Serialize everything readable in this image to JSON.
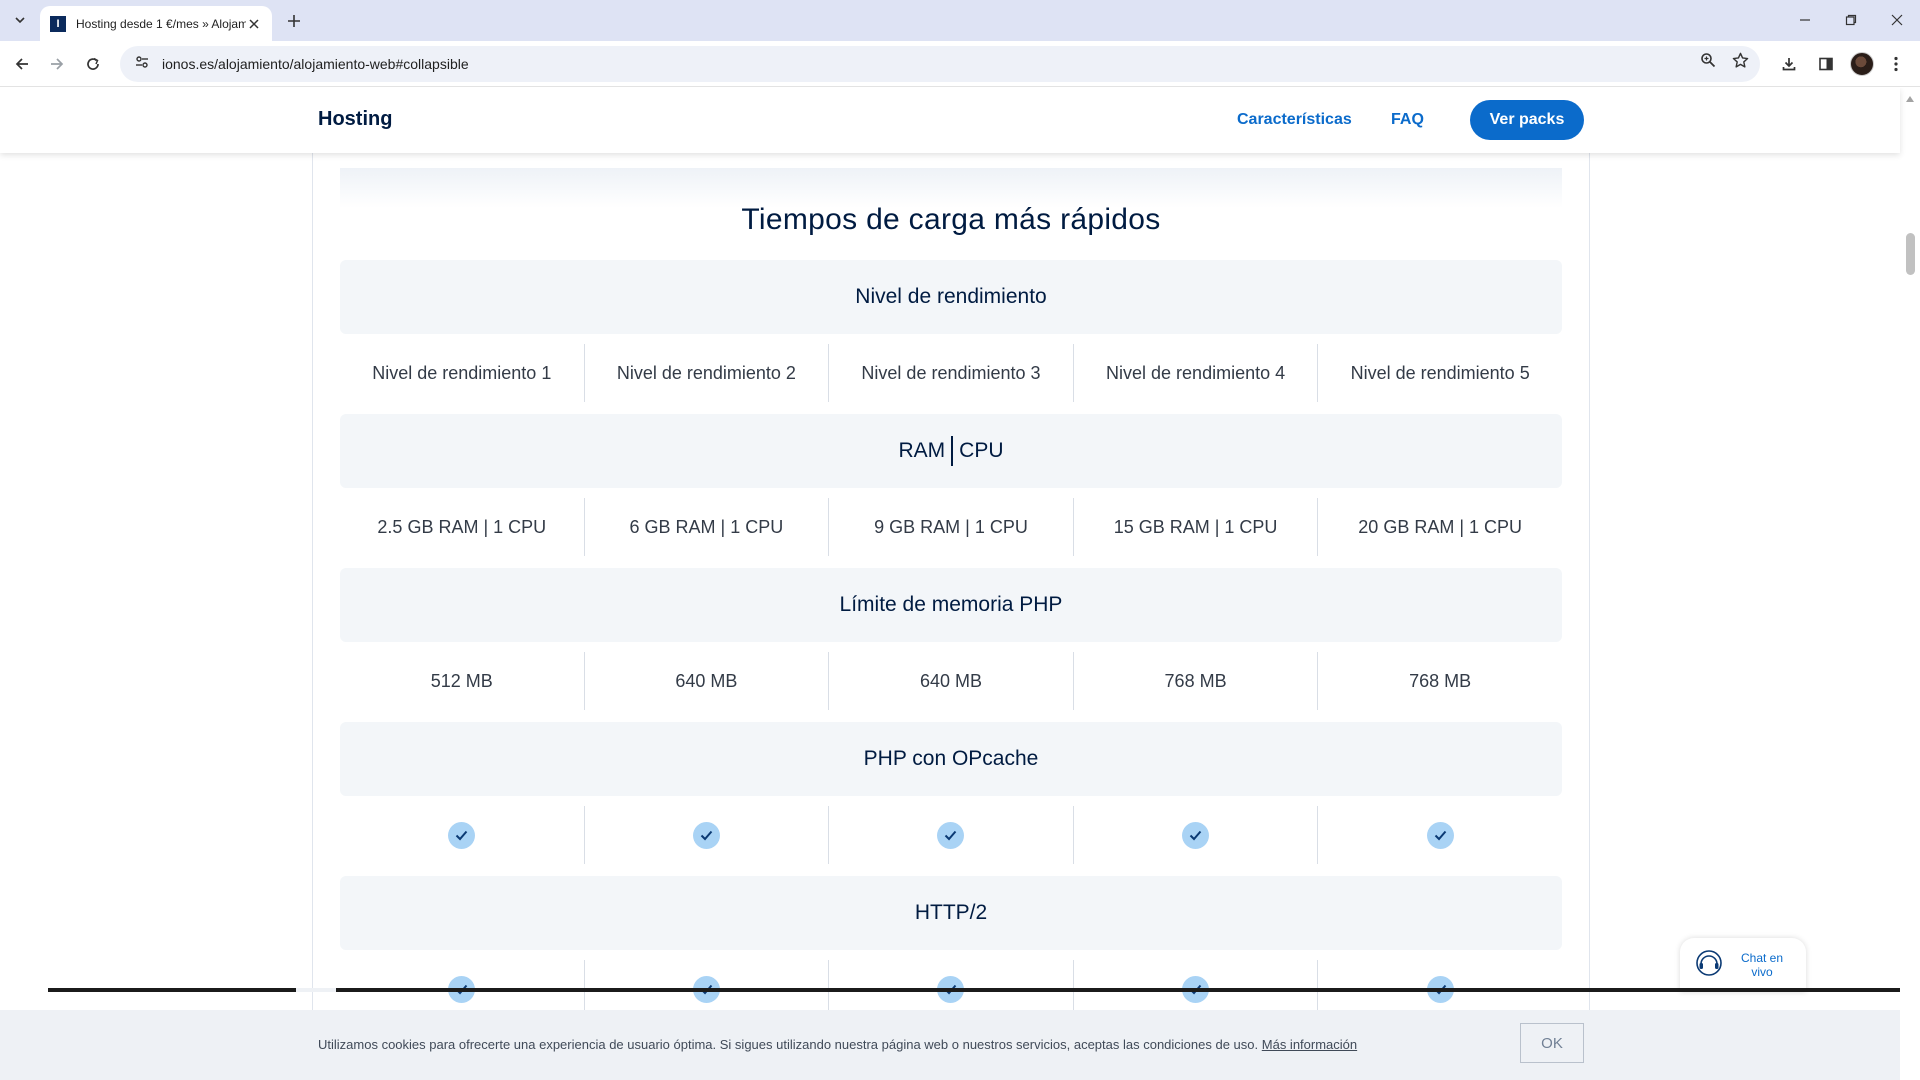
{
  "browser": {
    "tab_title": "Hosting desde 1 €/mes » Alojamiento",
    "favicon_letter": "I",
    "url": "ionos.es/alojamiento/alojamiento-web#collapsible"
  },
  "header": {
    "brand": "Hosting",
    "nav": [
      "Características",
      "FAQ"
    ],
    "cta": "Ver packs"
  },
  "section": {
    "title": "Tiempos de carga más rápidos"
  },
  "groups": {
    "performance": {
      "title": "Nivel de rendimiento",
      "values": [
        "Nivel de rendimiento 1",
        "Nivel de rendimiento 2",
        "Nivel de rendimiento 3",
        "Nivel de rendimiento 4",
        "Nivel de rendimiento 5"
      ]
    },
    "ram_cpu": {
      "title_left": "RAM",
      "title_right": "CPU",
      "values": [
        "2.5 GB RAM | 1 CPU",
        "6 GB RAM | 1 CPU",
        "9 GB RAM | 1 CPU",
        "15 GB RAM | 1 CPU",
        "20 GB RAM | 1 CPU"
      ]
    },
    "php_memory": {
      "title": "Límite de memoria PHP",
      "values": [
        "512 MB",
        "640 MB",
        "640 MB",
        "768 MB",
        "768 MB"
      ]
    },
    "opcache": {
      "title": "PHP con OPcache",
      "included": [
        true,
        true,
        true,
        true,
        true
      ]
    },
    "http2": {
      "title": "HTTP/2",
      "included": [
        true,
        true,
        true,
        true,
        true
      ]
    }
  },
  "cookie": {
    "text": "Utilizamos cookies para ofrecerte una experiencia de usuario óptima. Si sigues utilizando nuestra página web o nuestros servicios, aceptas las condiciones de uso.",
    "link": "Más información",
    "ok": "OK"
  },
  "chat": {
    "line1": "Chat en",
    "line2": "vivo"
  },
  "colors": {
    "accent": "#0b6bcb",
    "text_dark": "#001b41",
    "check_fill": "#a9d3f5",
    "group_bg": "#f3f6f9"
  }
}
